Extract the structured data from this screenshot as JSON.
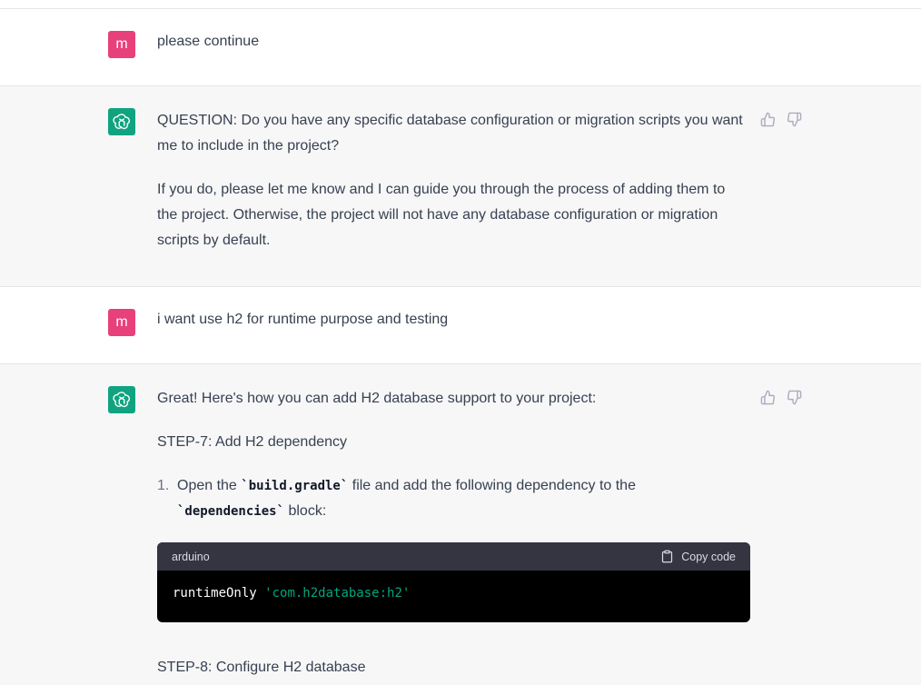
{
  "thread": {
    "messages": [
      {
        "role": "user",
        "avatar_letter": "m",
        "text": "please continue"
      },
      {
        "role": "assistant",
        "paragraphs": [
          "QUESTION: Do you have any specific database configuration or migration scripts you want me to include in the project?",
          "If you do, please let me know and I can guide you through the process of adding them to the project. Otherwise, the project will not have any database configuration or migration scripts by default."
        ]
      },
      {
        "role": "user",
        "avatar_letter": "m",
        "text": "i want use h2 for runtime purpose and testing"
      },
      {
        "role": "assistant",
        "intro": "Great! Here's how you can add H2 database support to your project:",
        "step7": "STEP-7: Add H2 dependency",
        "list_item": {
          "number": "1.",
          "pre": "Open the ",
          "code1": "`build.gradle`",
          "mid": " file and add the following dependency to the",
          "code2": "`dependencies`",
          "post": " block:"
        },
        "codeblock": {
          "language": "arduino",
          "copy_label": "Copy code",
          "code_plain": "runtimeOnly ",
          "code_string": "'com.h2database:h2'"
        },
        "step8": "STEP-8: Configure H2 database"
      }
    ]
  },
  "colors": {
    "user_avatar": "#e8407a",
    "assistant_avatar": "#10a37f",
    "assistant_bg": "#f7f7f8",
    "code_header": "#343541",
    "code_string": "#00a67d"
  },
  "icons": [
    "openai-logo-icon",
    "thumbs-up-icon",
    "thumbs-down-icon",
    "clipboard-icon"
  ]
}
